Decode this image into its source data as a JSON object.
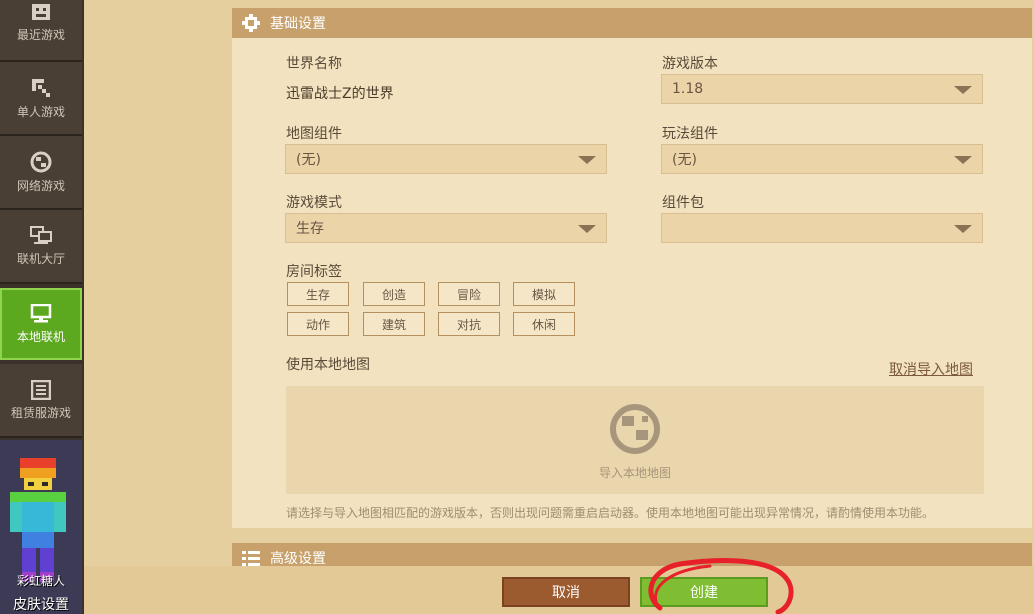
{
  "sidebar": {
    "items": [
      {
        "label": "最近游戏",
        "icon": "gamepad-icon",
        "active": false
      },
      {
        "label": "单人游戏",
        "icon": "pickaxe-icon",
        "active": false
      },
      {
        "label": "网络游戏",
        "icon": "globe-icon",
        "active": false
      },
      {
        "label": "联机大厅",
        "icon": "network-icon",
        "active": false
      },
      {
        "label": "本地联机",
        "icon": "monitor-icon",
        "active": true
      },
      {
        "label": "租赁服游戏",
        "icon": "server-list-icon",
        "active": false
      }
    ],
    "skin": {
      "name": "彩虹糖人",
      "label": "皮肤设置"
    }
  },
  "basic_settings": {
    "title": "基础设置",
    "world_name_label": "世界名称",
    "world_name_value": "迅雷战士Z的世界",
    "version_label": "游戏版本",
    "version_value": "1.18",
    "map_component_label": "地图组件",
    "map_component_value": "(无)",
    "gameplay_component_label": "玩法组件",
    "gameplay_component_value": "(无)",
    "game_mode_label": "游戏模式",
    "game_mode_value": "生存",
    "component_pack_label": "组件包",
    "component_pack_value": "",
    "room_tags_label": "房间标签",
    "room_tags": [
      "生存",
      "创造",
      "冒险",
      "模拟",
      "动作",
      "建筑",
      "对抗",
      "休闲"
    ],
    "use_local_map_label": "使用本地地图",
    "cancel_import_link": "取消导入地图",
    "import_map_label": "导入本地地图",
    "note": "请选择与导入地图相匹配的游戏版本，否则出现问题需重启启动器。使用本地地图可能出现异常情况，请酌情使用本功能。"
  },
  "advanced_settings": {
    "title": "高级设置"
  },
  "footer": {
    "cancel_label": "取消",
    "create_label": "创建"
  },
  "colors": {
    "accent_green": "#7fbd33",
    "cancel_brown": "#9c5a2f",
    "header_tan": "#c7a06b",
    "annotation_red": "#e8202a"
  }
}
